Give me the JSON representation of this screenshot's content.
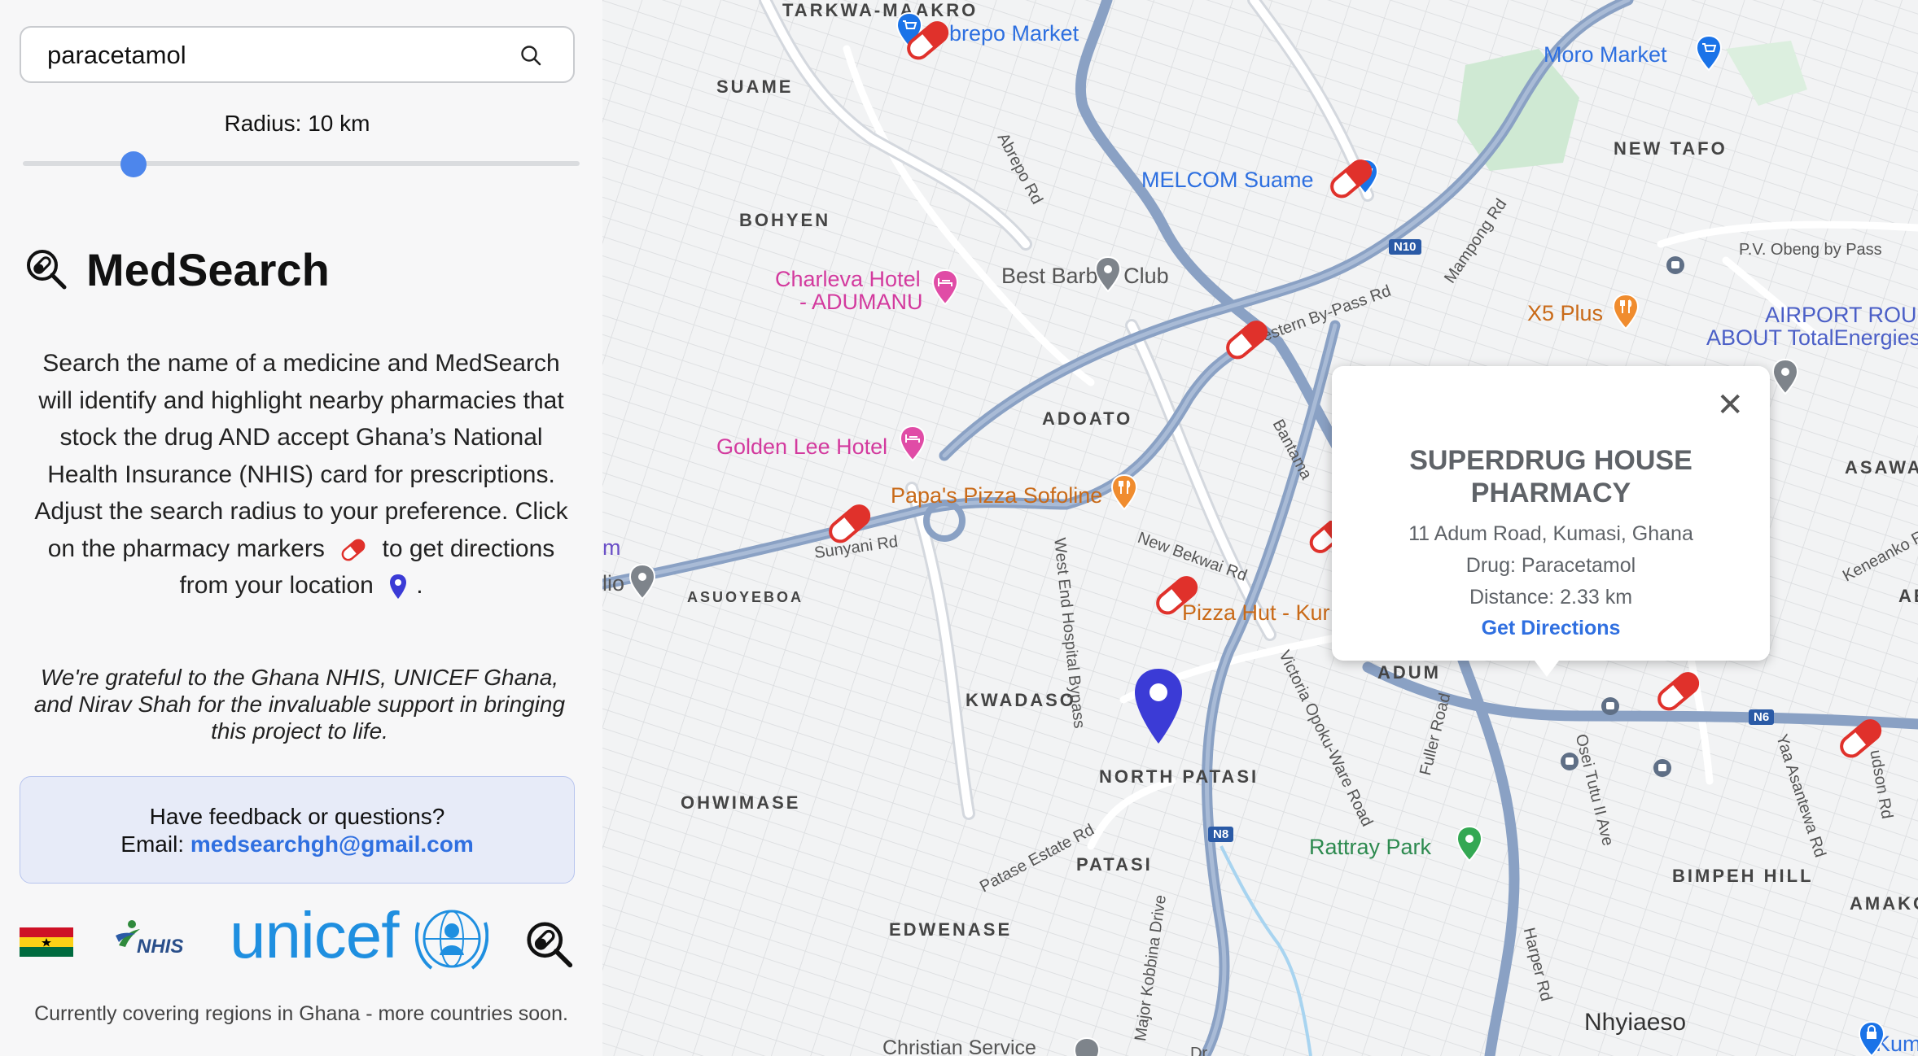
{
  "search": {
    "value": "paracetamol",
    "icon": "search-icon"
  },
  "radius": {
    "label": "Radius: 10 km",
    "value_km": 10
  },
  "brand": {
    "title": "MedSearch",
    "icon": "medsearch-logo-icon"
  },
  "description": {
    "text": "Search the name of a medicine and MedSearch will identify and highlight nearby pharmacies that stock the drug AND accept Ghana’s National Health Insurance (NHIS) card for prescriptions. Adjust the search radius to your preference. Click on the pharmacy markers",
    "text_mid": "to get directions from your location",
    "text_end": "."
  },
  "thanks": "We're grateful to the Ghana NHIS, UNICEF Ghana, and Nirav Shah for the invaluable support in bringing this project to life.",
  "feedback": {
    "question": "Have feedback or questions?",
    "email_label": "Email:",
    "email": "medsearchgh@gmail.com"
  },
  "logos": {
    "nhis": "NHIS",
    "unicef": "unicef"
  },
  "coverage": "Currently covering regions in Ghana - more countries soon.",
  "colors": {
    "accent": "#4d86ec",
    "pill_red": "#e0312b",
    "user_pin": "#3b3bd6",
    "link": "#2f6fe0"
  },
  "map": {
    "areas": [
      "TARKWA-MAAKRO",
      "SUAME",
      "NEW TAFO",
      "BOHYEN",
      "ADOATO",
      "ASAWASI",
      "ASUOYEBOA",
      "KWADASO",
      "ADUM",
      "NORTH PATASI",
      "OHWIMASE",
      "PATASI",
      "EDWENASE",
      "BIMPEH HILL",
      "AMAKOM",
      "AE"
    ],
    "pois": {
      "abrepo_market": "brepo Market",
      "moro_market": "Moro Market",
      "melcom": "MELCOM Suame",
      "charleva_1": "Charleva Hotel",
      "charleva_2": "- ADUMANU",
      "best_barber": "Best Barber Club",
      "x5_plus": "X5 Plus",
      "airport_1": "AIRPORT ROUN",
      "airport_2": "ABOUT TotalEnergies",
      "golden_lee": "Golden Lee Hotel",
      "papas_pizza": "Papa's Pizza Sofoline",
      "pizza_hut": "Pizza Hut - Kur",
      "rattray": "Rattray Park",
      "nhyiaeso": "Nhyiaeso",
      "christian": "Christian Service",
      "kumasi": "Kumasi",
      "left_m": "m",
      "left_lio": "lio"
    },
    "roads": {
      "abrepo_rd": "Abrepo Rd",
      "western_bypass": "Western By-Pass Rd",
      "mampong_rd": "Mampong Rd",
      "pv_obeng": "P.V. Obeng by Pass",
      "sunyani_rd": "Sunyani Rd",
      "new_bekwai": "New Bekwai Rd",
      "west_end": "West End Hospital Bypass",
      "bantama": "Bantama",
      "victoria": "Victoria Opoku-Ware Road",
      "fuller": "Fuller Road",
      "osei_tutu": "Osei Tutu II Ave",
      "patase_estate": "Patase Estate Rd",
      "major_kobbina": "Major Kobbina Drive",
      "harper": "Harper Rd",
      "yaa_asantewa": "Yaa Asantewa Rd",
      "hudson": "udson Rd",
      "keneanko": "Keneanko Rd",
      "dr": "Dr"
    },
    "shields": {
      "n10": "N10",
      "n6": "N6",
      "n8": "N8"
    }
  },
  "popup": {
    "title": "SUPERDRUG HOUSE PHARMACY",
    "address": "11 Adum Road, Kumasi, Ghana",
    "drug": "Drug: Paracetamol",
    "distance": "Distance: 2.33 km",
    "link": "Get Directions",
    "close": "✕"
  }
}
